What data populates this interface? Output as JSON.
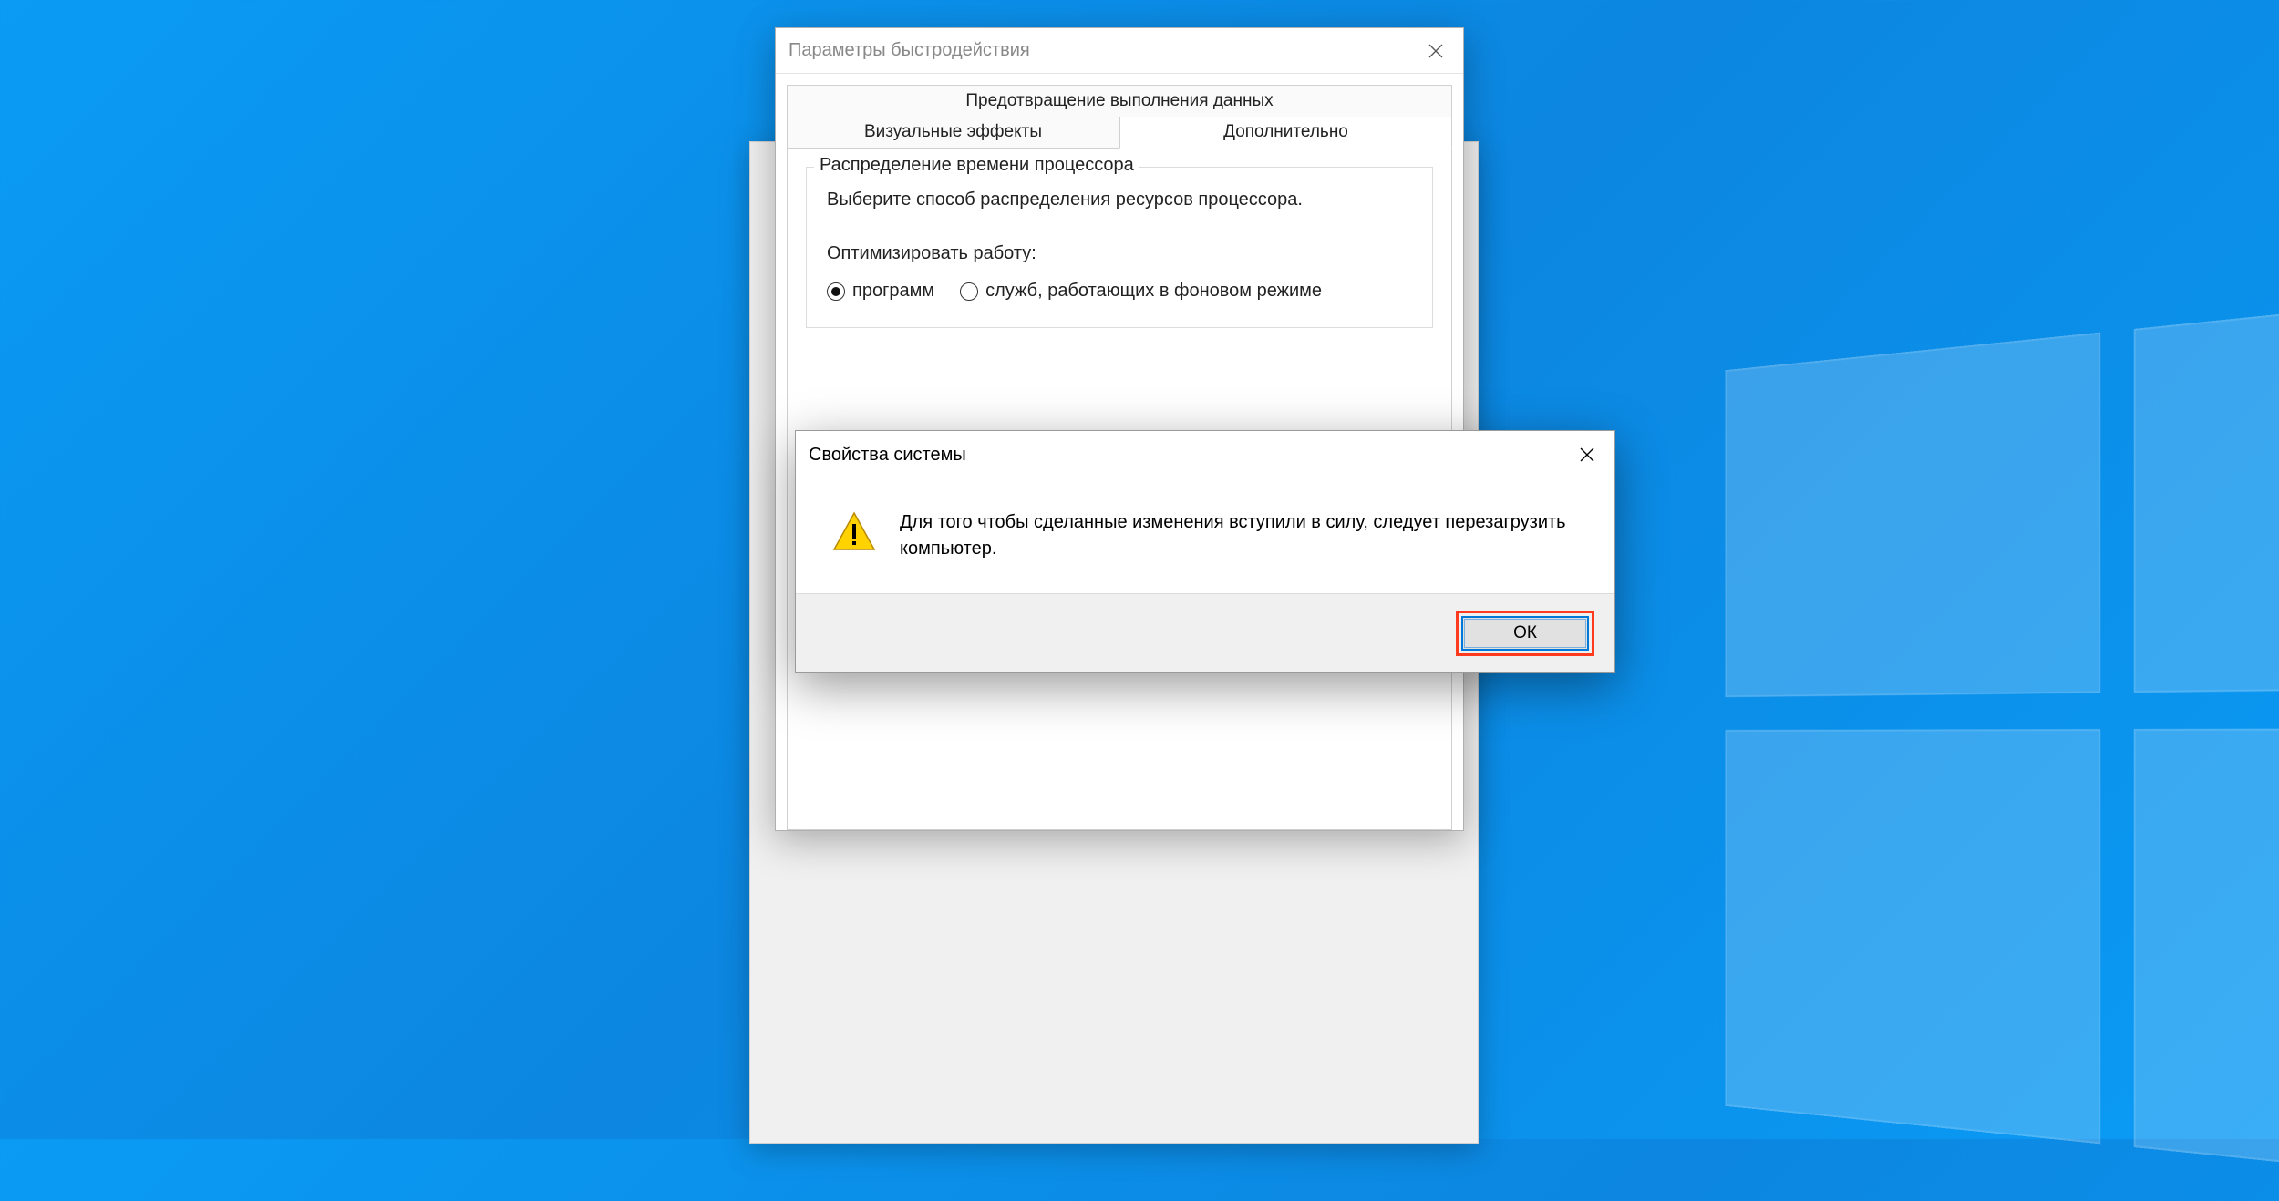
{
  "perf_dialog": {
    "title": "Параметры быстродействия",
    "tabs": {
      "dep": "Предотвращение выполнения данных",
      "visual": "Визуальные эффекты",
      "advanced": "Дополнительно"
    },
    "group": {
      "legend": "Распределение времени процессора",
      "desc": "Выберите способ распределения ресурсов процессора.",
      "optimize_label": "Оптимизировать работу:",
      "radio_programs": "программ",
      "radio_services": "служб, работающих в фоновом режиме"
    }
  },
  "msgbox": {
    "title": "Свойства системы",
    "message": "Для того чтобы сделанные изменения вступили в силу, следует перезагрузить компьютер.",
    "ok": "ОК"
  }
}
